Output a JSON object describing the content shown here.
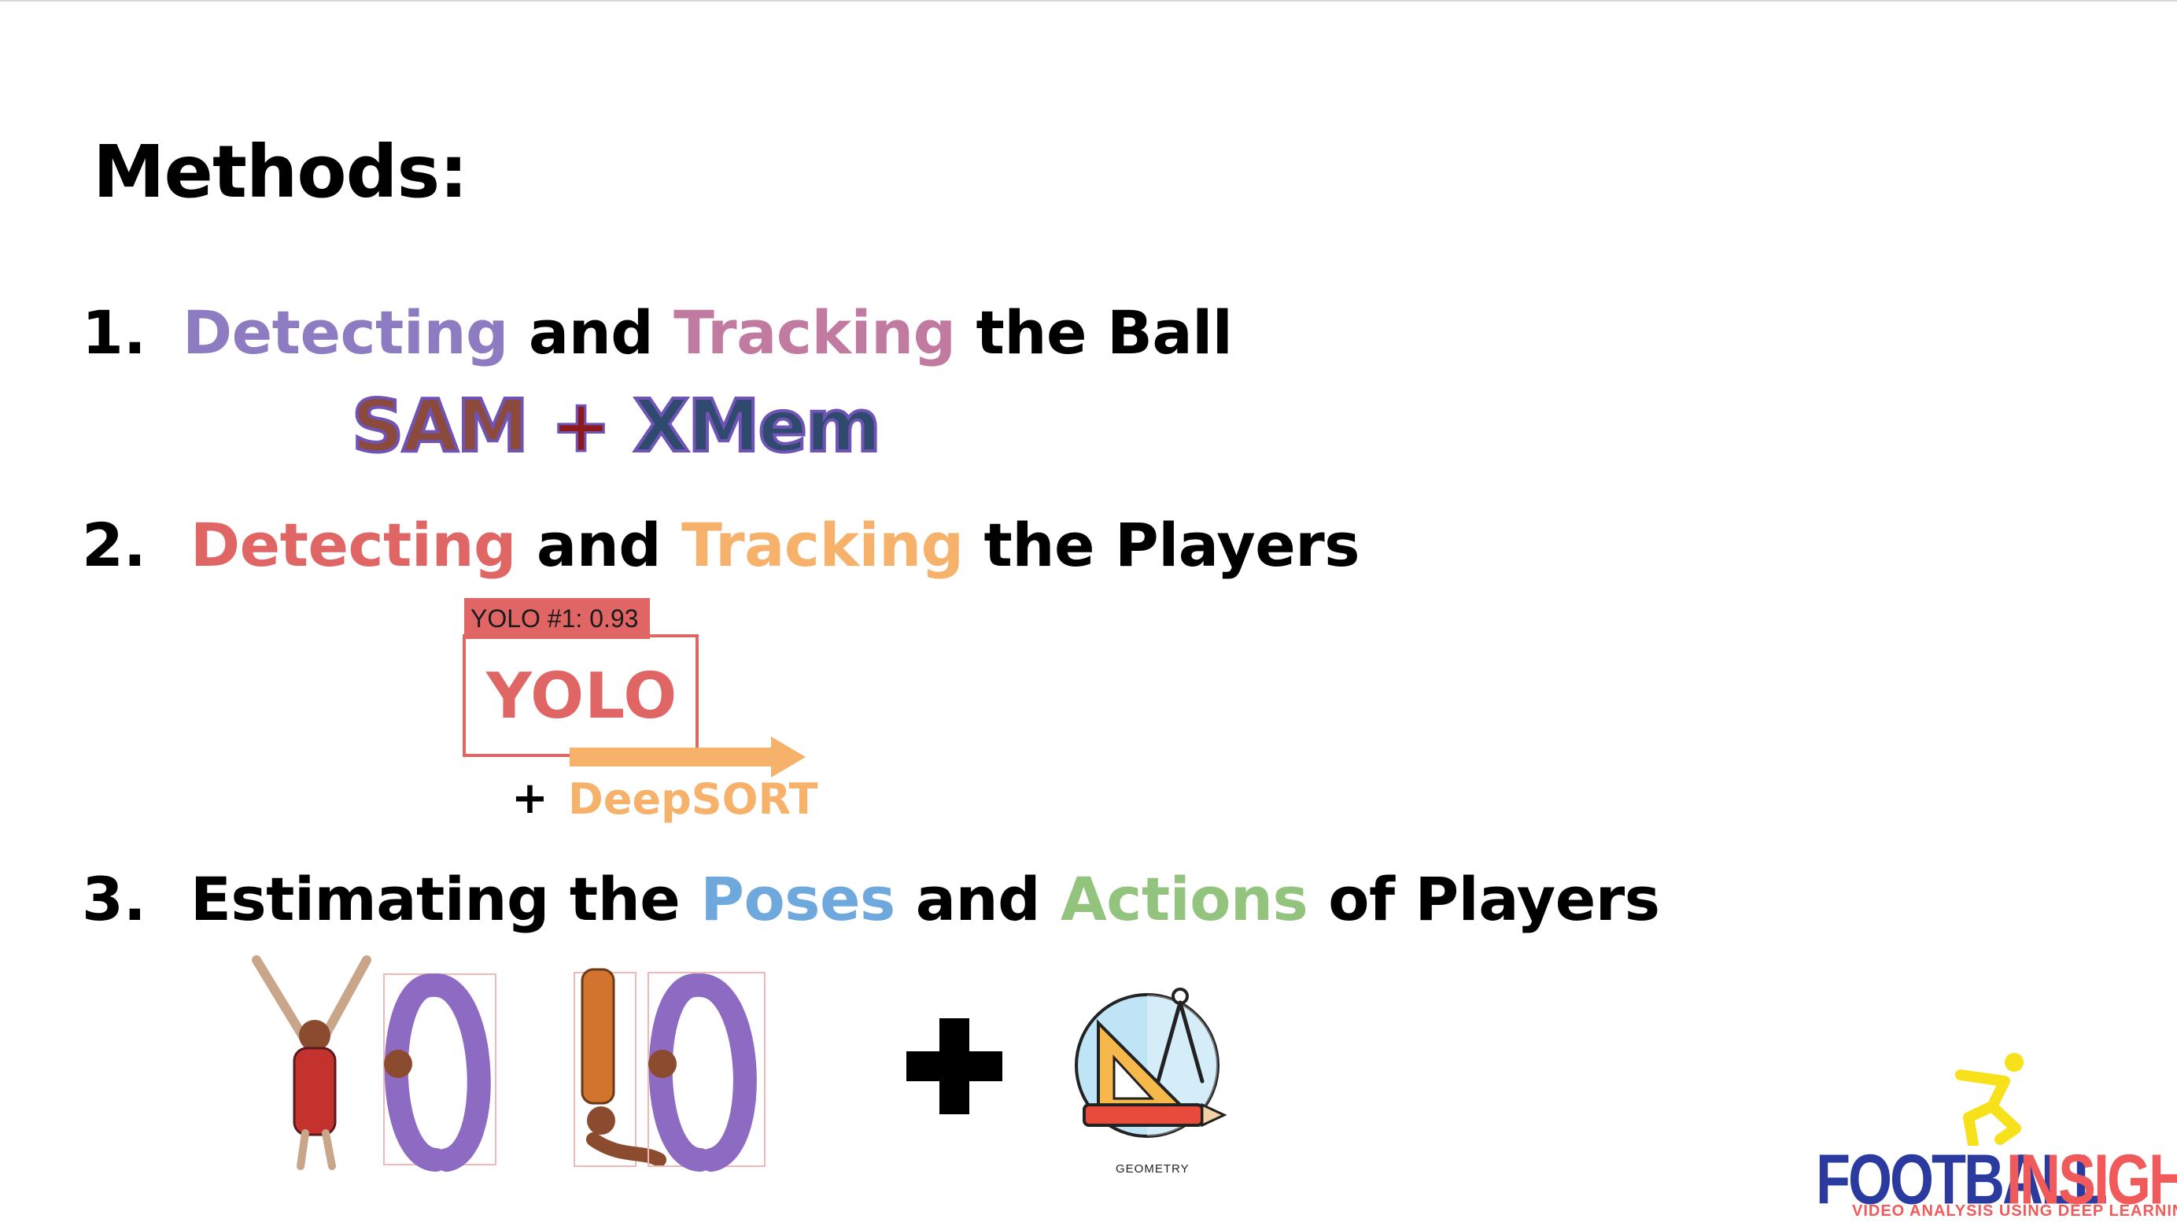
{
  "slide": {
    "title": "Methods:",
    "items": [
      {
        "number": "1.",
        "parts": [
          {
            "text": "Detecting",
            "color": "#8e7cc3"
          },
          {
            "text": " and ",
            "color": "#000000"
          },
          {
            "text": "Tracking",
            "color": "#c27ba0"
          },
          {
            "text": " the Ball",
            "color": "#000000"
          }
        ],
        "method": {
          "sam": "SAM",
          "plus": "+",
          "xmem": "XMem"
        }
      },
      {
        "number": "2.",
        "parts": [
          {
            "text": "Detecting",
            "color": "#e06666"
          },
          {
            "text": " and ",
            "color": "#000000"
          },
          {
            "text": "Tracking",
            "color": "#f6b26b"
          },
          {
            "text": " the Players",
            "color": "#000000"
          }
        ],
        "method": {
          "box_label": "YOLO #1: 0.93",
          "yolo": "YOLO",
          "plus": "+",
          "tracker": "DeepSORT"
        }
      },
      {
        "number": "3.",
        "parts": [
          {
            "text": "Estimating the ",
            "color": "#000000"
          },
          {
            "text": "Poses",
            "color": "#6fa8dc"
          },
          {
            "text": " and ",
            "color": "#000000"
          },
          {
            "text": "Actions",
            "color": "#93c47d"
          },
          {
            "text": " of Players",
            "color": "#000000"
          }
        ],
        "method": {
          "geometry_label": "GEOMETRY"
        }
      }
    ]
  },
  "logo": {
    "word1": "FOOTBALL",
    "word2": "INSIGHTS",
    "tagline": "VIDEO ANALYSIS USING DEEP LEARNING"
  },
  "colors": {
    "purple": "#8e7cc3",
    "pink": "#c27ba0",
    "red": "#e06666",
    "orange": "#f6b26b",
    "blue": "#6fa8dc",
    "green": "#93c47d",
    "logo_blue": "#2b3a9e",
    "logo_red": "#f05a5a",
    "logo_yellow": "#f7e11a"
  },
  "icons": [
    "yolo-pose-letters-image",
    "plus-icon",
    "geometry-icon",
    "football-player-logo-icon"
  ]
}
